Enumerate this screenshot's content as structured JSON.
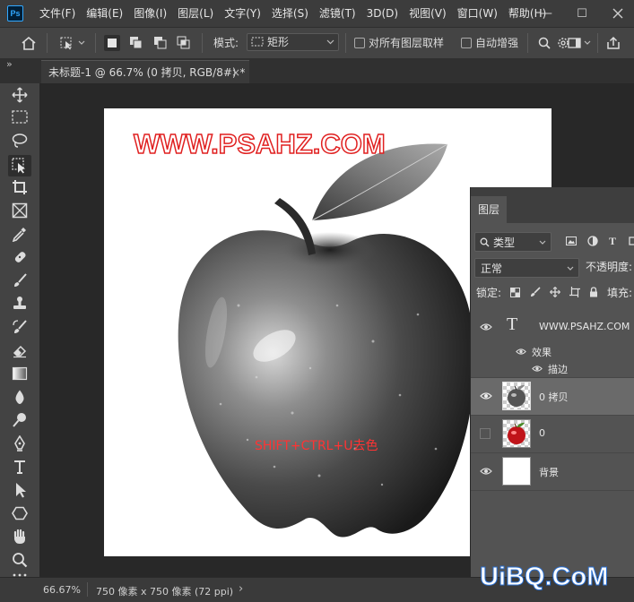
{
  "app": {
    "logo_text": "Ps"
  },
  "menu": [
    "文件(F)",
    "编辑(E)",
    "图像(I)",
    "图层(L)",
    "文字(Y)",
    "选择(S)",
    "滤镜(T)",
    "3D(D)",
    "视图(V)",
    "窗口(W)",
    "帮助(H)"
  ],
  "window_controls": {
    "minimize": "—",
    "maximize": "☐"
  },
  "options": {
    "mode_label": "模式:",
    "mode_value": "矩形",
    "sample_all_layers": "对所有图层取样",
    "auto_enhance": "自动增强"
  },
  "document_tab": {
    "title": "未标题-1 @ 66.7% (0 拷贝, RGB/8#) *",
    "close": "×"
  },
  "panel_collapse": "»",
  "canvas": {
    "watermark": "WWW.PSAHZ.COM",
    "annotation": "SHIFT+CTRL+U去色"
  },
  "status": {
    "zoom": "66.67%",
    "doc_size": "750 像素 x 750 像素 (72 ppi)",
    "more": "›"
  },
  "layers_panel": {
    "tab": "图层",
    "filter_kind": "类型",
    "blend_mode": "正常",
    "opacity_label": "不透明度:",
    "lock_label": "锁定:",
    "fill_label": "填充:",
    "layers": [
      {
        "name": "WWW.PSAHZ.COM",
        "type": "text",
        "visible": true,
        "selected": false
      },
      {
        "name": "0 拷贝",
        "type": "image-gray",
        "visible": true,
        "selected": true
      },
      {
        "name": "0",
        "type": "image-color",
        "visible": false,
        "selected": false
      },
      {
        "name": "背景",
        "type": "fill-white",
        "visible": true,
        "selected": false
      }
    ],
    "effects_label": "效果",
    "stroke_label": "描边"
  },
  "site_watermark": "UiBQ.CoM",
  "colors": {
    "annotation_red": "#ff3333",
    "watermark_red": "#e02020",
    "brand_blue": "#31a8ff"
  }
}
